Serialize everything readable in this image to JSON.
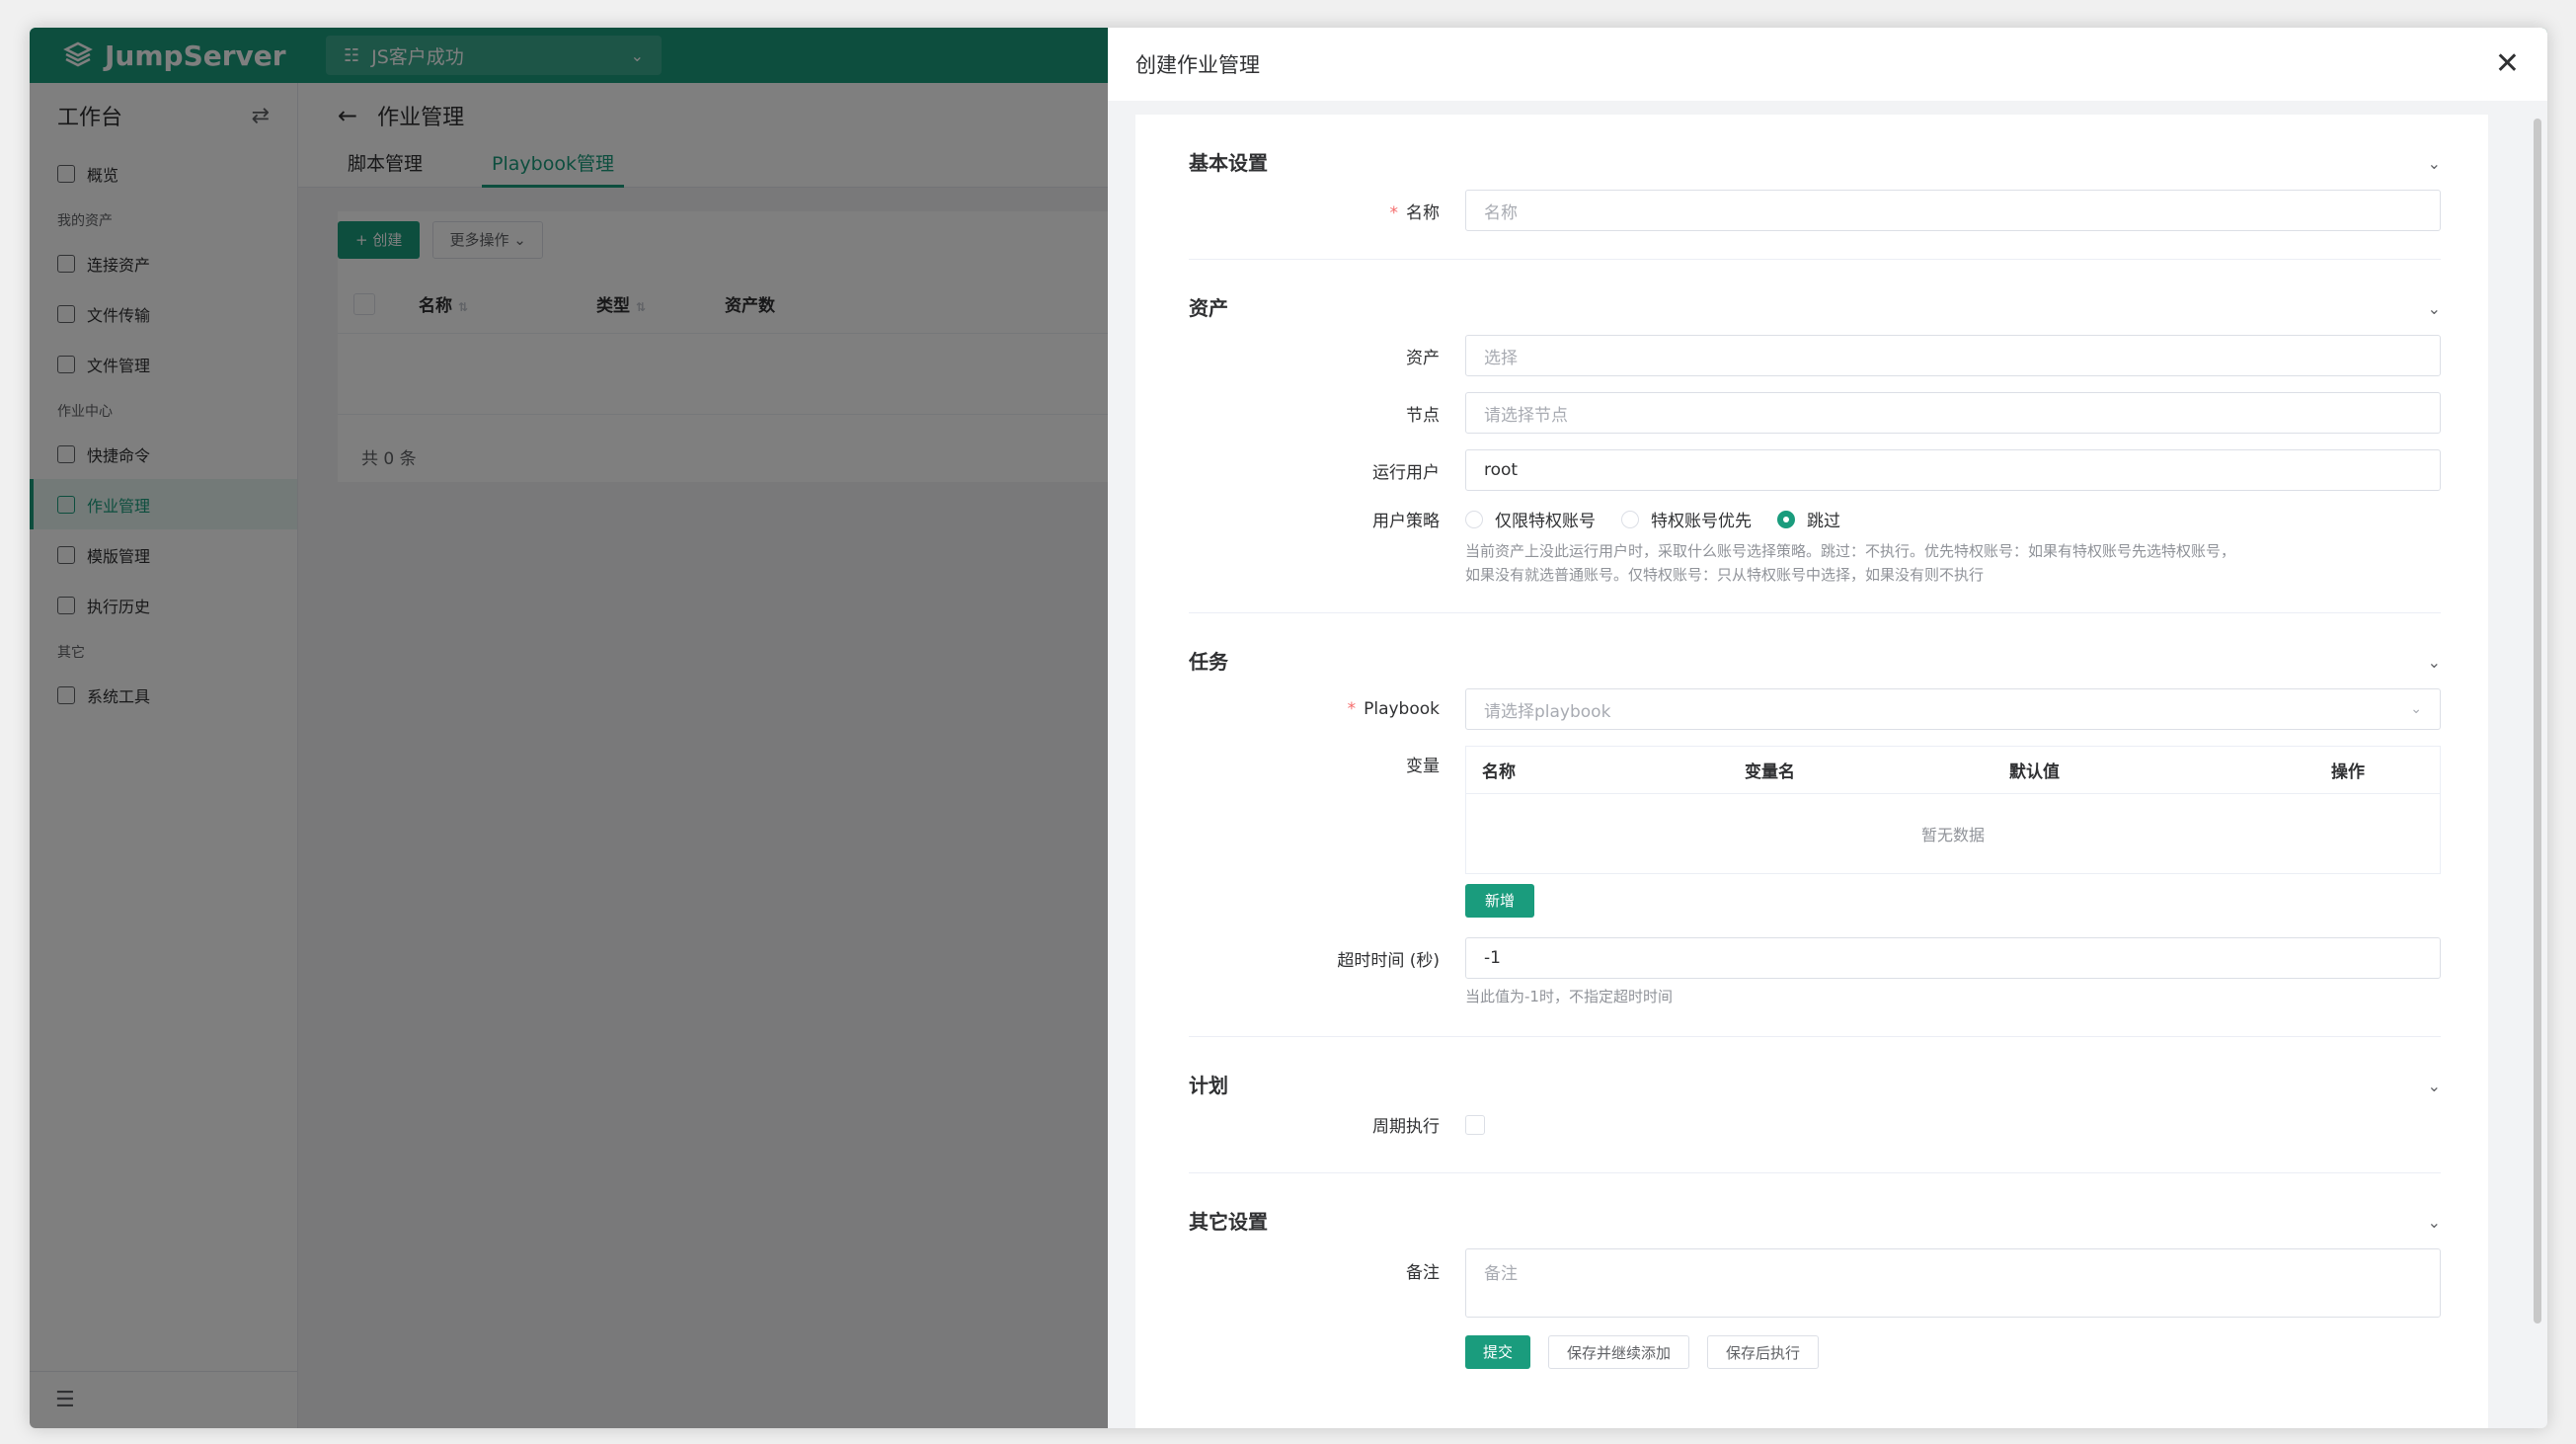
{
  "app": {
    "logo_text": "JumpServer",
    "org": "JS客户成功"
  },
  "sidebar": {
    "title": "工作台",
    "items": [
      {
        "type": "item",
        "label": "概览",
        "icon": "monitor-icon"
      },
      {
        "type": "group",
        "label": "我的资产"
      },
      {
        "type": "item",
        "label": "连接资产",
        "icon": "monitor-icon"
      },
      {
        "type": "item",
        "label": "文件传输",
        "icon": "file-transfer-icon"
      },
      {
        "type": "item",
        "label": "文件管理",
        "icon": "external-link-icon"
      },
      {
        "type": "group",
        "label": "作业中心"
      },
      {
        "type": "item",
        "label": "快捷命令",
        "icon": "play-circle-icon"
      },
      {
        "type": "item",
        "label": "作业管理",
        "icon": "checklist-icon",
        "active": true
      },
      {
        "type": "item",
        "label": "模版管理",
        "icon": "template-icon"
      },
      {
        "type": "item",
        "label": "执行历史",
        "icon": "history-icon"
      },
      {
        "type": "group",
        "label": "其它"
      },
      {
        "type": "item",
        "label": "系统工具",
        "icon": "toolbox-icon"
      }
    ]
  },
  "page": {
    "title": "作业管理",
    "tabs": [
      {
        "label": "脚本管理"
      },
      {
        "label": "Playbook管理",
        "active": true
      }
    ],
    "create_btn": "+ 创建",
    "more_btn": "更多操作",
    "columns": {
      "name": "名称",
      "type": "类型",
      "assets": "资产数"
    },
    "total": "共 0 条"
  },
  "drawer": {
    "title": "创建作业管理",
    "sections": {
      "basic": {
        "title": "基本设置",
        "name_label": "名称",
        "name_placeholder": "名称"
      },
      "assets": {
        "title": "资产",
        "asset_label": "资产",
        "asset_placeholder": "选择",
        "node_label": "节点",
        "node_placeholder": "请选择节点",
        "runas_label": "运行用户",
        "runas_value": "root",
        "policy_label": "用户策略",
        "policy_options": [
          "仅限特权账号",
          "特权账号优先",
          "跳过"
        ],
        "policy_selected": "跳过",
        "policy_help_1": "当前资产上没此运行用户时，采取什么账号选择策略。跳过：不执行。优先特权账号：如果有特权账号先选特权账号，",
        "policy_help_2": "如果没有就选普通账号。仅特权账号：只从特权账号中选择，如果没有则不执行"
      },
      "task": {
        "title": "任务",
        "playbook_label": "Playbook",
        "playbook_placeholder": "请选择playbook",
        "vars_label": "变量",
        "vars_columns": [
          "名称",
          "变量名",
          "默认值",
          "操作"
        ],
        "vars_empty": "暂无数据",
        "add_btn": "新增",
        "timeout_label": "超时时间 (秒)",
        "timeout_value": "-1",
        "timeout_help": "当此值为-1时，不指定超时时间"
      },
      "schedule": {
        "title": "计划",
        "periodic_label": "周期执行"
      },
      "other": {
        "title": "其它设置",
        "comment_label": "备注",
        "comment_placeholder": "备注"
      }
    },
    "buttons": {
      "submit": "提交",
      "save_continue": "保存并继续添加",
      "save_execute": "保存后执行"
    }
  },
  "colors": {
    "brand": "#1a9c7d",
    "required": "#f56c6c"
  }
}
